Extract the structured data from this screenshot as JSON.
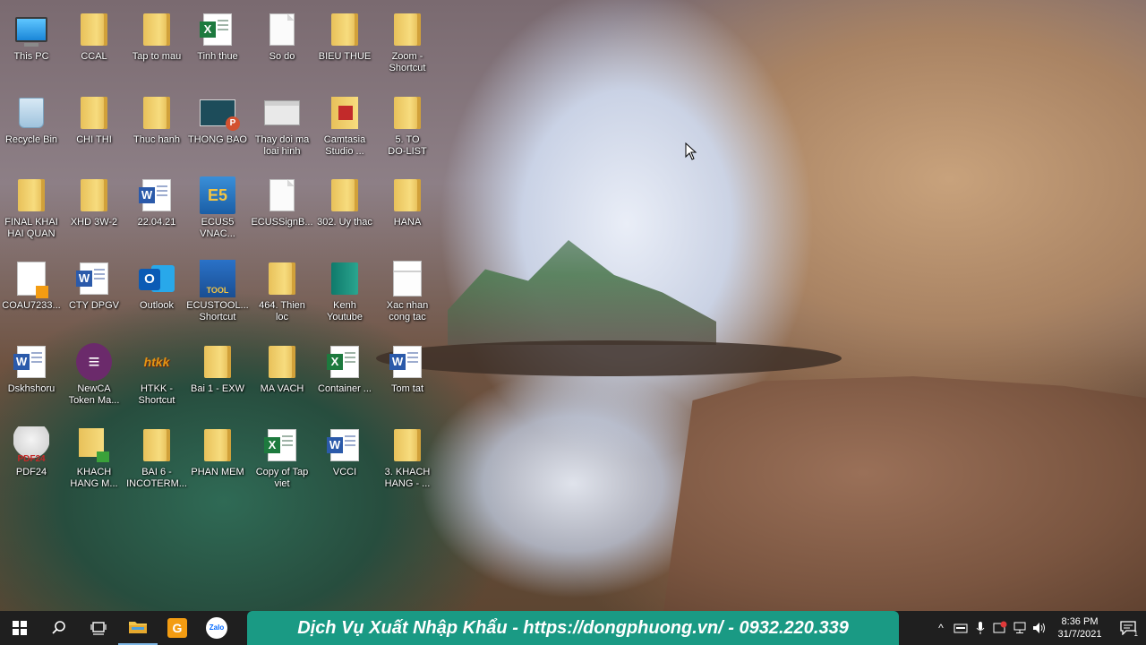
{
  "desktop": {
    "icons": [
      {
        "label": "This PC",
        "type": "pc"
      },
      {
        "label": "CCAL",
        "type": "folder"
      },
      {
        "label": "Tap to mau",
        "type": "folder"
      },
      {
        "label": "Tinh thue",
        "type": "excel"
      },
      {
        "label": "So do",
        "type": "file"
      },
      {
        "label": "BIEU THUE",
        "type": "folder"
      },
      {
        "label": "Zoom -\nShortcut",
        "type": "folder"
      },
      {
        "label": "Recycle Bin",
        "type": "bin"
      },
      {
        "label": "CHI THI",
        "type": "folder"
      },
      {
        "label": "Thuc hanh",
        "type": "folder"
      },
      {
        "label": "THONG BAO",
        "type": "ppt"
      },
      {
        "label": "Thay doi ma\nloai hinh",
        "type": "window"
      },
      {
        "label": "Camtasia\nStudio ...",
        "type": "camtasia"
      },
      {
        "label": "5. TO\nDO-LIST",
        "type": "folder"
      },
      {
        "label": "FINAL KHAI\nHAI QUAN",
        "type": "folder"
      },
      {
        "label": "XHD 3W-2",
        "type": "folder"
      },
      {
        "label": "22.04.21",
        "type": "word"
      },
      {
        "label": "ECUS5\nVNAC...",
        "type": "ecus"
      },
      {
        "label": "ECUSSignB...",
        "type": "file"
      },
      {
        "label": "302. Uy thac",
        "type": "folder"
      },
      {
        "label": "HANA",
        "type": "folder"
      },
      {
        "label": "COAU7233...",
        "type": "sheet"
      },
      {
        "label": "CTY DPGV",
        "type": "word"
      },
      {
        "label": "Outlook",
        "type": "outlook"
      },
      {
        "label": "ECUSTOOL...\nShortcut",
        "type": "ecustool"
      },
      {
        "label": "464. Thien\nloc",
        "type": "folder"
      },
      {
        "label": "Kenh\nYoutube",
        "type": "teal"
      },
      {
        "label": "Xac nhan\ncong tac",
        "type": "doc"
      },
      {
        "label": "Dskhshoru",
        "type": "word"
      },
      {
        "label": "NewCA\nToken Ma...",
        "type": "newca"
      },
      {
        "label": "HTKK -\nShortcut",
        "type": "htkk"
      },
      {
        "label": "Bai 1 - EXW",
        "type": "folder"
      },
      {
        "label": "MA VACH",
        "type": "folder"
      },
      {
        "label": "Container ...",
        "type": "excel"
      },
      {
        "label": "Tom tat",
        "type": "word"
      },
      {
        "label": "PDF24",
        "type": "pdf24"
      },
      {
        "label": "KHACH\nHANG M...",
        "type": "khach"
      },
      {
        "label": "BAI 6 -\nINCOTERM...",
        "type": "folder"
      },
      {
        "label": "PHAN MEM",
        "type": "folder"
      },
      {
        "label": "Copy of Tap\nviet",
        "type": "excel"
      },
      {
        "label": "VCCI",
        "type": "word"
      },
      {
        "label": "3. KHACH\nHANG - ...",
        "type": "folder"
      }
    ]
  },
  "taskbar": {
    "buttons": [
      {
        "name": "start-button",
        "icon": "windows-logo-icon"
      },
      {
        "name": "search-button",
        "icon": "search-icon"
      },
      {
        "name": "task-view-button",
        "icon": "task-view-icon"
      },
      {
        "name": "file-explorer-button",
        "icon": "folder-icon"
      },
      {
        "name": "app-g-button",
        "icon": "app-g-icon"
      },
      {
        "name": "zalo-button",
        "icon": "zalo-icon"
      }
    ],
    "banner_text": "Dịch Vụ Xuất Nhập Khẩu - https://dongphuong.vn/ - 0932.220.339",
    "zalo_label": "Zalo",
    "tray": {
      "chevron": "^",
      "time": "8:36 PM",
      "date": "31/7/2021",
      "notification_count": "1"
    }
  },
  "colors": {
    "banner": "#1a9a84",
    "taskbar": "#1f1f1f"
  }
}
